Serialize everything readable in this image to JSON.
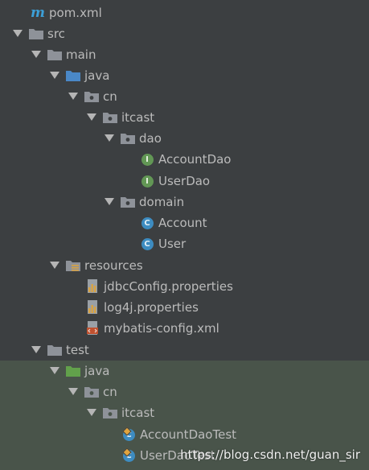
{
  "tree": {
    "items": [
      {
        "label": "pom.xml",
        "icon": "maven-icon"
      },
      {
        "label": "src",
        "icon": "folder-icon"
      },
      {
        "label": "main",
        "icon": "folder-icon"
      },
      {
        "label": "java",
        "icon": "source-folder-icon"
      },
      {
        "label": "cn",
        "icon": "package-icon"
      },
      {
        "label": "itcast",
        "icon": "package-icon"
      },
      {
        "label": "dao",
        "icon": "package-icon"
      },
      {
        "label": "AccountDao",
        "icon": "interface-icon"
      },
      {
        "label": "UserDao",
        "icon": "interface-icon"
      },
      {
        "label": "domain",
        "icon": "package-icon"
      },
      {
        "label": "Account",
        "icon": "class-icon"
      },
      {
        "label": "User",
        "icon": "class-icon"
      },
      {
        "label": "resources",
        "icon": "resources-folder-icon"
      },
      {
        "label": "jdbcConfig.properties",
        "icon": "properties-file-icon"
      },
      {
        "label": "log4j.properties",
        "icon": "properties-file-icon"
      },
      {
        "label": "mybatis-config.xml",
        "icon": "xml-file-icon"
      },
      {
        "label": "test",
        "icon": "folder-icon"
      },
      {
        "label": "java",
        "icon": "test-source-folder-icon"
      },
      {
        "label": "cn",
        "icon": "package-icon"
      },
      {
        "label": "itcast",
        "icon": "package-icon"
      },
      {
        "label": "AccountDaoTest",
        "icon": "test-class-icon"
      },
      {
        "label": "UserDaoTest",
        "icon": "test-class-icon"
      }
    ],
    "interface_badge": "I",
    "class_badge": "C"
  },
  "watermark": "https://blog.csdn.net/guan_sir",
  "colors": {
    "background": "#3c3f41",
    "test_background": "#49544a",
    "text": "#bbbbbb",
    "folder": "#8e9299",
    "source_folder": "#4a88c7",
    "test_folder": "#62a14b",
    "interface": "#629755",
    "class": "#3d8cc1"
  }
}
